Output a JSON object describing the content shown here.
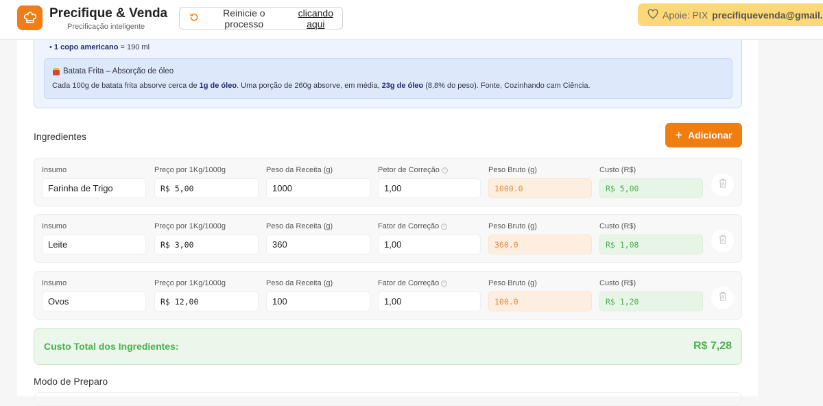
{
  "header": {
    "title": "Precifique & Venda",
    "subtitle": "Precificação inteligente",
    "reset_prefix": "Reinicie o processo",
    "reset_link": "clicando aqui",
    "pix_prefix": "Apoie: PIX",
    "pix_email": "precifiquevenda@gmail.com"
  },
  "info": {
    "measure_bold": "1 copo americano",
    "measure_rest": "= 190 ml",
    "tip_title": "Batata Frita – Absorção de óleo",
    "tip_p1": "Cada 100g de batata frita absorve cerca de ",
    "tip_b1": "1g de óleo",
    "tip_p2": ". Uma porção de 260g absorve, em média, ",
    "tip_b2": "23g de óleo",
    "tip_p3": " (8,8% do peso). Fonte, Cozinhando cam Ciência."
  },
  "ingredients": {
    "title": "Ingredientes",
    "add_label": "Adicionar",
    "rows": [
      {
        "labels": [
          "Insumo",
          "Preço por 1Kg/1000g",
          "Peso da Receita (g)",
          "Petor de Correção",
          "Peso Bruto (g)",
          "Custo (R$)"
        ],
        "insumo": "Farinha de Trigo",
        "preco": "R$ 5,00",
        "peso": "1000",
        "fator": "1,00",
        "bruto": "1000.0",
        "custo": "R$ 5,00"
      },
      {
        "labels": [
          "Insumo",
          "Preço por 1Kg/1000g",
          "Peso da Receita (g)",
          "Fator de Correção",
          "Peso Bruto (g)",
          "Custo (R$)"
        ],
        "insumo": "Leite",
        "preco": "R$ 3,00",
        "peso": "360",
        "fator": "1,00",
        "bruto": "360.0",
        "custo": "R$ 1,08"
      },
      {
        "labels": [
          "Insumo",
          "Preço por 1Kg/1000g",
          "Peso da Receita (g)",
          "Fator de Correção",
          "Peso Bruto (g)",
          "Custo (R$)"
        ],
        "insumo": "Ovos",
        "preco": "R$ 12,00",
        "peso": "100",
        "fator": "1,00",
        "bruto": "100.0",
        "custo": "R$ 1,20"
      }
    ]
  },
  "total": {
    "label": "Custo Total dos Ingredientes:",
    "value": "R$ 7,28"
  },
  "prep": {
    "title": "Modo de Preparo"
  },
  "colors": {
    "accent": "#f07d10",
    "success": "#4caf50",
    "pix": "#fcd877"
  }
}
